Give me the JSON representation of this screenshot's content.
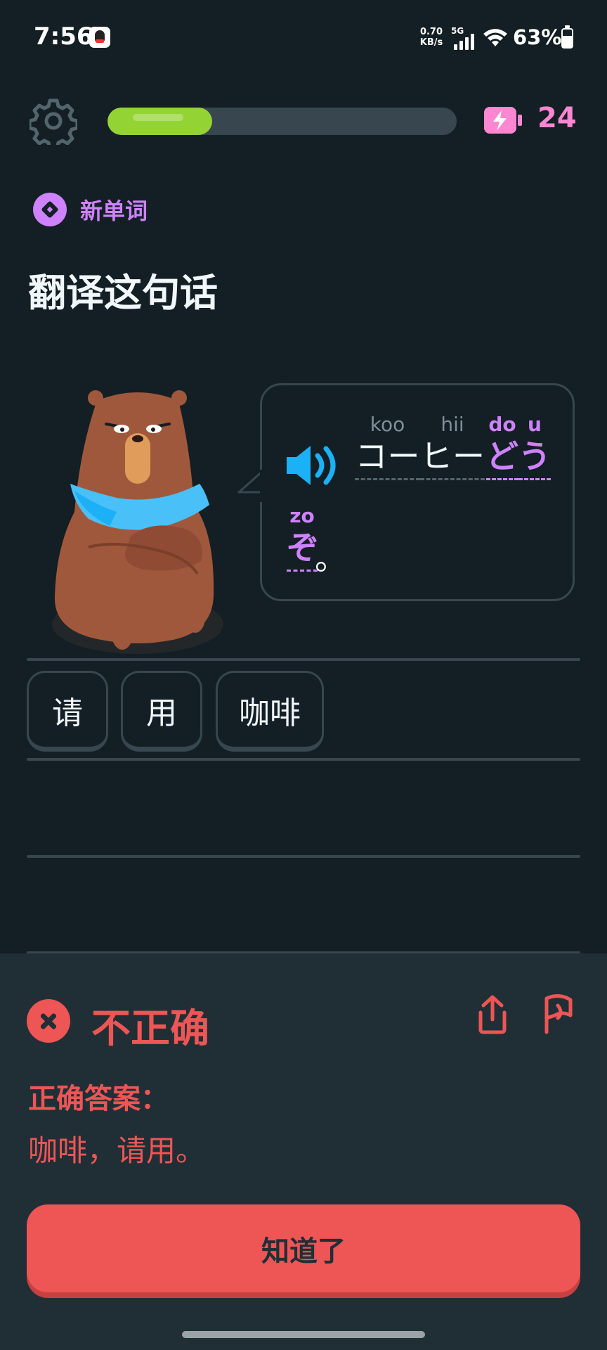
{
  "status_bar": {
    "time": "7:56",
    "net_speed_value": "0.70",
    "net_speed_unit": "KB/s",
    "network_type": "5G",
    "battery_percent": "63%",
    "battery_level": 0.63,
    "icons": [
      "qq-icon",
      "signal-icon",
      "wifi-icon",
      "battery-icon"
    ]
  },
  "header": {
    "progress_fraction": 0.3,
    "energy_count": "24",
    "colors": {
      "progress": "#93d333",
      "energy": "#ff86d0"
    }
  },
  "lesson": {
    "badge": "新单词",
    "title": "翻译这句话"
  },
  "prompt": {
    "tokens": [
      {
        "text": "コー",
        "furigana": "koo",
        "is_new": false
      },
      {
        "text": "ヒー",
        "furigana": "hii",
        "is_new": false
      },
      {
        "text": "ど",
        "furigana": "do",
        "is_new": true
      },
      {
        "text": "う",
        "furigana": "u",
        "is_new": true
      },
      {
        "text": "ぞ",
        "furigana": "zo",
        "is_new": true
      }
    ],
    "punctuation": "。"
  },
  "word_bank": {
    "chips": [
      "请",
      "用",
      "咖啡"
    ]
  },
  "feedback": {
    "title": "不正确",
    "answer_label": "正确答案：",
    "answer_text": "咖啡，请用。",
    "button_label": "知道了",
    "colors": {
      "error": "#ee5555",
      "panel": "#202f36"
    }
  }
}
